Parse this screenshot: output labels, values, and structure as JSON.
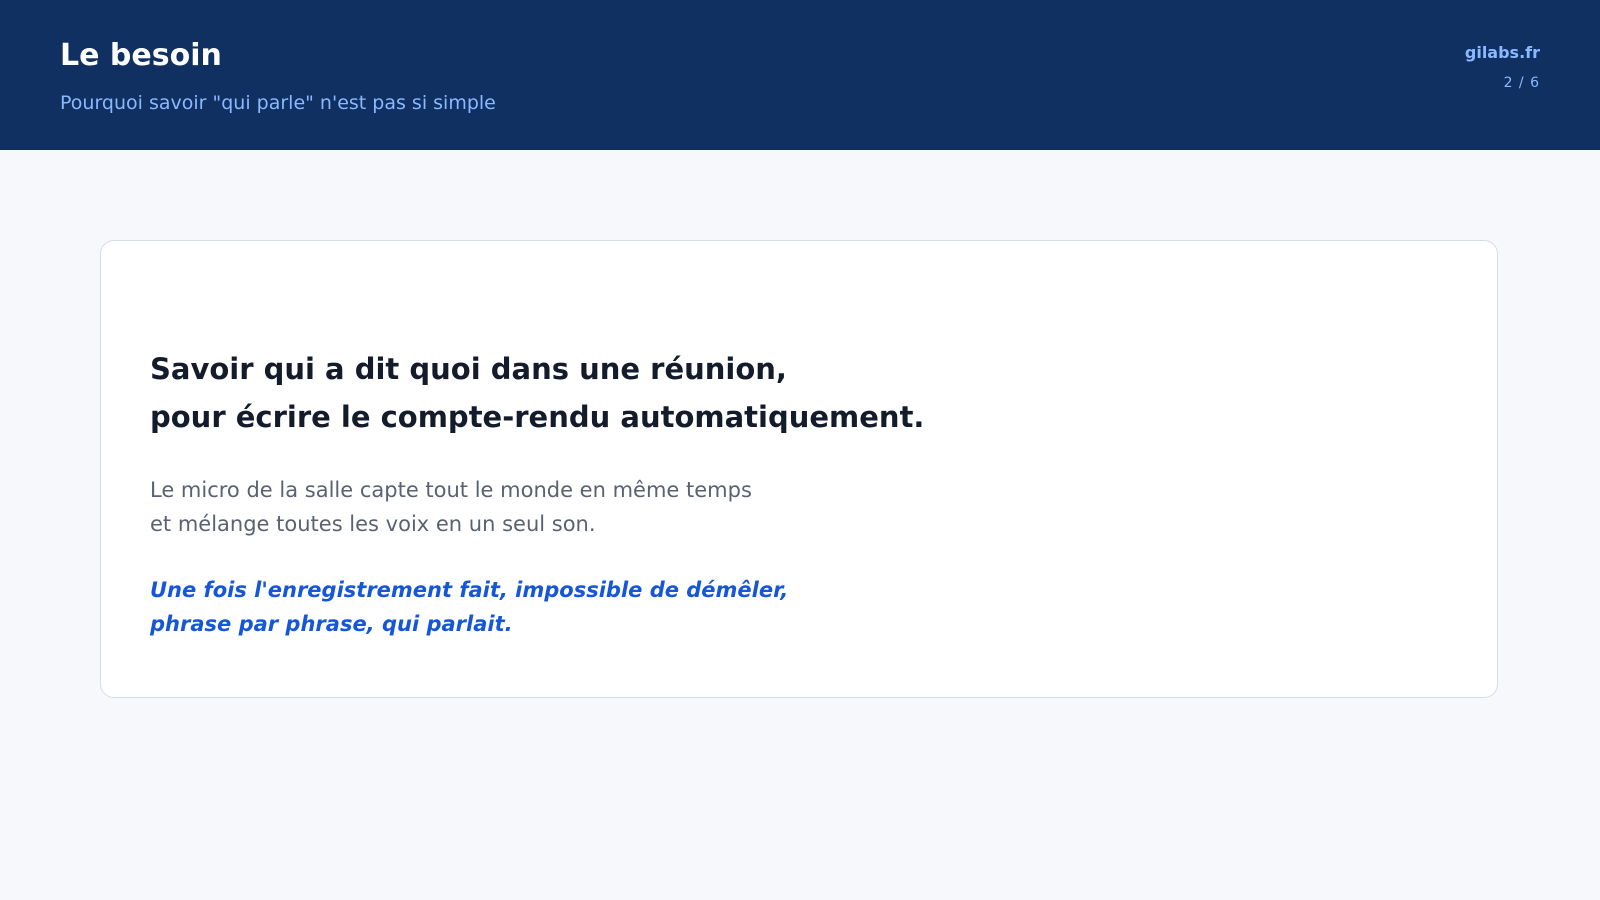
{
  "header": {
    "title": "Le besoin",
    "subtitle": "Pourquoi savoir \"qui parle\" n'est pas si simple",
    "brand": "gilabs.fr",
    "page_counter": "2 / 6"
  },
  "card": {
    "headline_lines": [
      "Savoir qui a dit quoi dans une réunion,",
      "pour écrire le compte-rendu automatiquement."
    ],
    "body_lines": [
      "Le micro de la salle capte tout le monde en même temps",
      "et mélange toutes les voix en un seul son."
    ],
    "emphasis_lines": [
      "Une fois l'enregistrement fait, impossible de démêler,",
      "phrase par phrase, qui parlait."
    ]
  },
  "colors": {
    "header_background": "#0f3061",
    "accent_light_blue": "#8cb8ff",
    "emphasis_blue": "#1557d6",
    "page_background": "#f6f8fb"
  }
}
